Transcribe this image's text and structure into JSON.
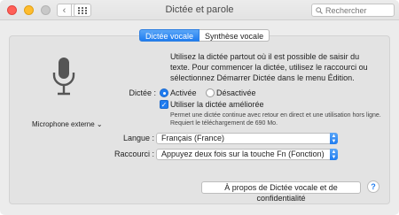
{
  "window": {
    "title": "Dictée et parole",
    "back_glyph": "‹",
    "forward_glyph": "›"
  },
  "search": {
    "placeholder": "Rechercher",
    "icon": "magnifier-icon"
  },
  "tabs": [
    {
      "label": "Dictée vocale",
      "active": true
    },
    {
      "label": "Synthèse vocale",
      "active": false
    }
  ],
  "microphone": {
    "icon": "microphone-icon",
    "source_label": "Microphone externe ⌄"
  },
  "description": "Utilisez la dictée partout où il est possible de saisir du texte. Pour commencer la dictée, utilisez le raccourci ou sélectionnez Démarrer Dictée dans le menu Édition.",
  "dictation": {
    "label": "Dictée :",
    "option_on": "Activée",
    "option_off": "Désactivée",
    "selected": "Activée"
  },
  "enhanced": {
    "label": "Utiliser la dictée améliorée",
    "checked": true,
    "note": "Permet une dictée continue avec retour en direct et une utilisation hors ligne. Requiert le téléchargement de 690 Mo."
  },
  "language": {
    "label": "Langue :",
    "value": "Français (France)"
  },
  "shortcut": {
    "label": "Raccourci :",
    "value": "Appuyez deux fois sur la touche Fn (Fonction)"
  },
  "about_button": "À propos de Dictée vocale et de confidentialité",
  "help_label": "?",
  "colors": {
    "accent": "#1f7cf0",
    "close": "#ff5f57",
    "minimize": "#febc2e"
  }
}
